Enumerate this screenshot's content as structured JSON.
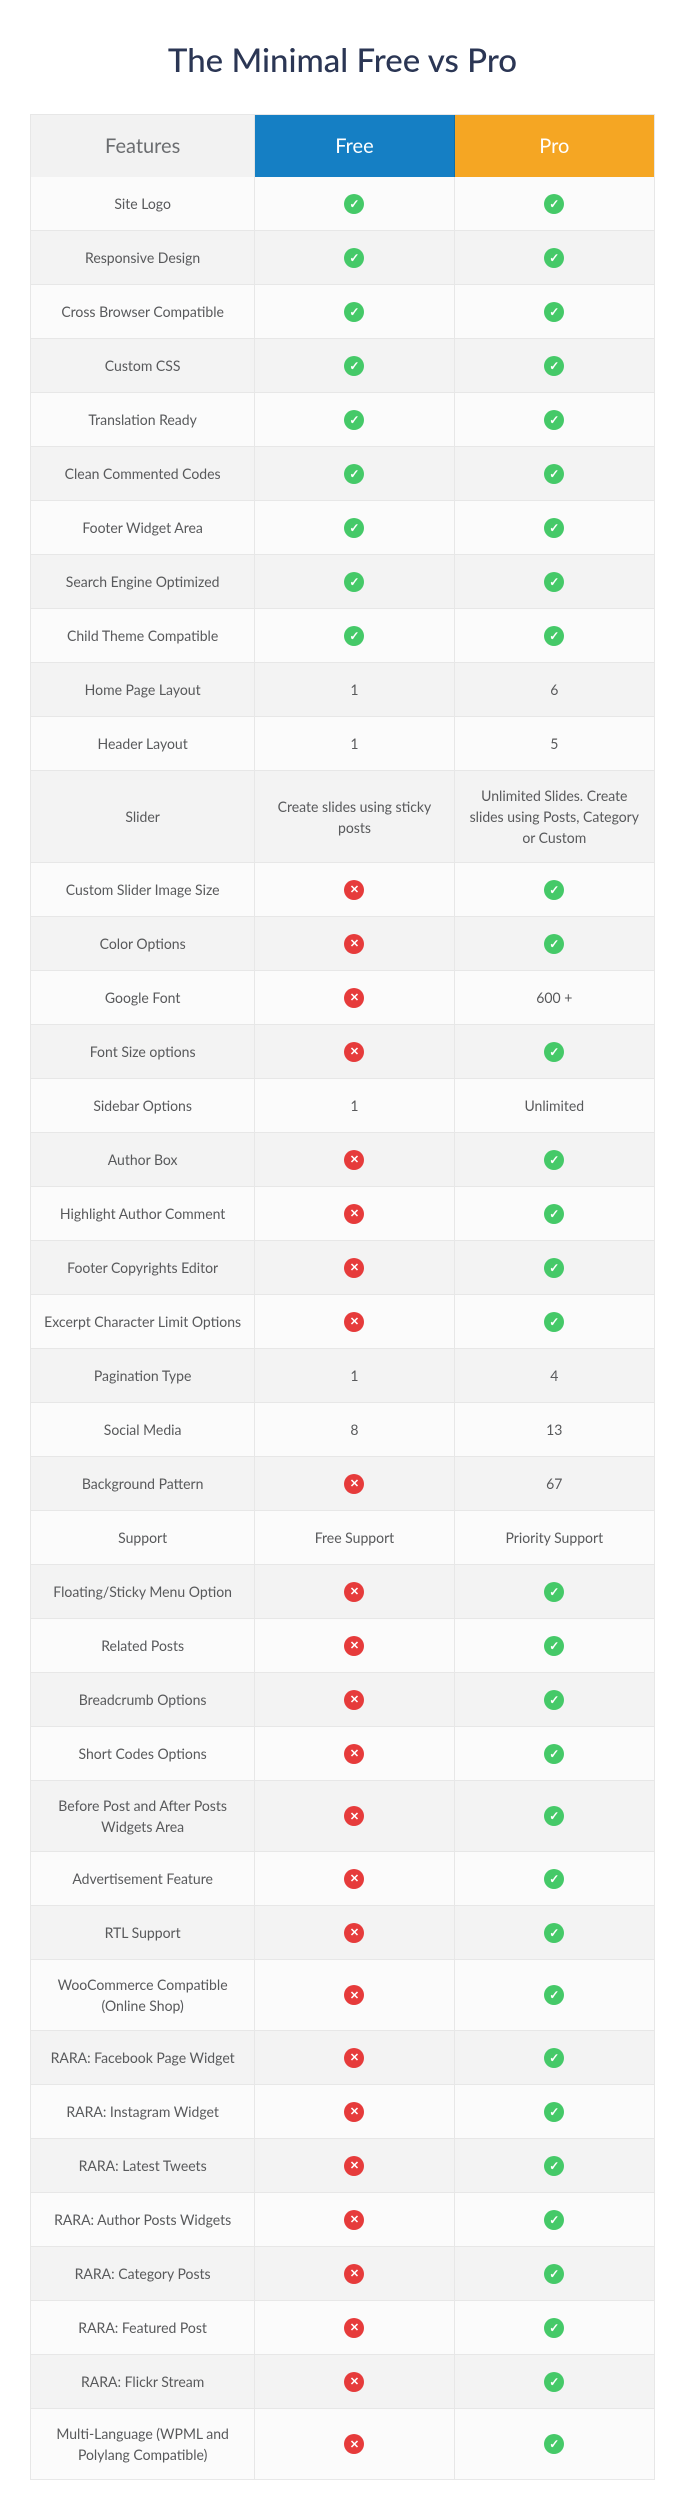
{
  "title": "The Minimal Free vs Pro",
  "columns": {
    "feature": "Features",
    "free": "Free",
    "pro": "Pro"
  },
  "rows": [
    {
      "feature": "Site Logo",
      "free": "check",
      "pro": "check"
    },
    {
      "feature": "Responsive Design",
      "free": "check",
      "pro": "check"
    },
    {
      "feature": "Cross Browser Compatible",
      "free": "check",
      "pro": "check"
    },
    {
      "feature": "Custom CSS",
      "free": "check",
      "pro": "check"
    },
    {
      "feature": "Translation Ready",
      "free": "check",
      "pro": "check"
    },
    {
      "feature": "Clean Commented Codes",
      "free": "check",
      "pro": "check"
    },
    {
      "feature": "Footer Widget Area",
      "free": "check",
      "pro": "check"
    },
    {
      "feature": "Search Engine Optimized",
      "free": "check",
      "pro": "check"
    },
    {
      "feature": "Child Theme Compatible",
      "free": "check",
      "pro": "check"
    },
    {
      "feature": "Home Page Layout",
      "free": "1",
      "pro": "6"
    },
    {
      "feature": "Header Layout",
      "free": "1",
      "pro": "5"
    },
    {
      "feature": "Slider",
      "free": "Create slides using sticky posts",
      "pro": "Unlimited Slides. Create slides using Posts, Category or Custom"
    },
    {
      "feature": "Custom Slider Image Size",
      "free": "cross",
      "pro": "check"
    },
    {
      "feature": "Color Options",
      "free": "cross",
      "pro": "check"
    },
    {
      "feature": "Google Font",
      "free": "cross",
      "pro": "600 +"
    },
    {
      "feature": "Font Size options",
      "free": "cross",
      "pro": "check"
    },
    {
      "feature": "Sidebar Options",
      "free": "1",
      "pro": "Unlimited"
    },
    {
      "feature": "Author Box",
      "free": "cross",
      "pro": "check"
    },
    {
      "feature": "Highlight Author Comment",
      "free": "cross",
      "pro": "check"
    },
    {
      "feature": "Footer Copyrights Editor",
      "free": "cross",
      "pro": "check"
    },
    {
      "feature": "Excerpt Character Limit Options",
      "free": "cross",
      "pro": "check"
    },
    {
      "feature": "Pagination Type",
      "free": "1",
      "pro": "4"
    },
    {
      "feature": "Social Media",
      "free": "8",
      "pro": "13"
    },
    {
      "feature": "Background Pattern",
      "free": "cross",
      "pro": "67"
    },
    {
      "feature": "Support",
      "free": "Free Support",
      "pro": "Priority Support"
    },
    {
      "feature": "Floating/Sticky Menu Option",
      "free": "cross",
      "pro": "check"
    },
    {
      "feature": "Related Posts",
      "free": "cross",
      "pro": "check"
    },
    {
      "feature": "Breadcrumb Options",
      "free": "cross",
      "pro": "check"
    },
    {
      "feature": "Short Codes Options",
      "free": "cross",
      "pro": "check"
    },
    {
      "feature": "Before Post and After Posts Widgets Area",
      "free": "cross",
      "pro": "check"
    },
    {
      "feature": "Advertisement Feature",
      "free": "cross",
      "pro": "check"
    },
    {
      "feature": "RTL Support",
      "free": "cross",
      "pro": "check"
    },
    {
      "feature": "WooCommerce Compatible (Online Shop)",
      "free": "cross",
      "pro": "check"
    },
    {
      "feature": "RARA: Facebook Page Widget",
      "free": "cross",
      "pro": "check"
    },
    {
      "feature": "RARA: Instagram Widget",
      "free": "cross",
      "pro": "check"
    },
    {
      "feature": "RARA: Latest Tweets",
      "free": "cross",
      "pro": "check"
    },
    {
      "feature": "RARA: Author Posts Widgets",
      "free": "cross",
      "pro": "check"
    },
    {
      "feature": "RARA: Category Posts",
      "free": "cross",
      "pro": "check"
    },
    {
      "feature": "RARA: Featured Post",
      "free": "cross",
      "pro": "check"
    },
    {
      "feature": "RARA: Flickr Stream",
      "free": "cross",
      "pro": "check"
    },
    {
      "feature": "Multi-Language (WPML and Polylang Compatible)",
      "free": "cross",
      "pro": "check"
    }
  ]
}
